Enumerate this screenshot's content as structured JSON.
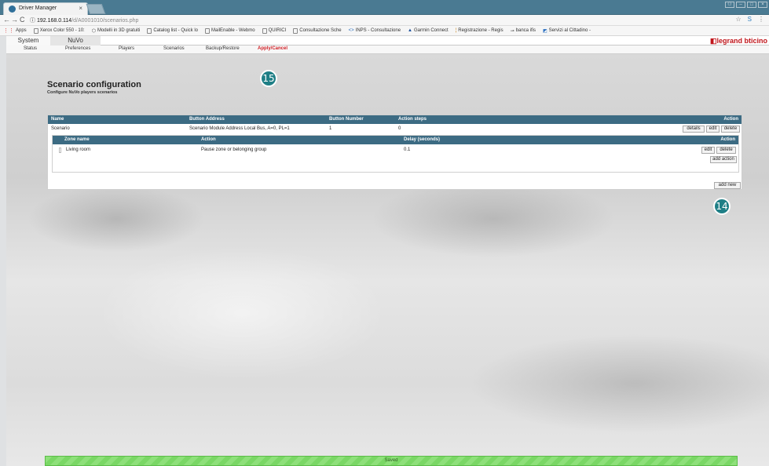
{
  "browser": {
    "tab_title": "Driver Manager",
    "url_host": "192.168.0.114",
    "url_path": "/d/A0001010/scenarios.php",
    "bookmarks": [
      "Apps",
      "Xerox Color 550 - 10:",
      "Modelli in 3D gratuiti",
      "Catalog list - Quick lo",
      "MailEnable - Webmo",
      "QUIRICI",
      "Consultazione Sche",
      "INPS - Consultazione",
      "Garmin Connect",
      "Registrazione - Regis",
      "banca ifis",
      "Servizi al Cittadino -"
    ]
  },
  "site": {
    "tabs": [
      "System",
      "NuVo"
    ],
    "brand_primary": "legrand",
    "brand_secondary": "bticino",
    "subnav": [
      "Status",
      "Preferences",
      "Players",
      "Scenarios",
      "Backup/Restore",
      "Apply/Cancel"
    ]
  },
  "page": {
    "title": "Scenario configuration",
    "subtitle": "Configure NuVo players scenarios"
  },
  "callouts": {
    "apply": "15",
    "add_new": "14"
  },
  "scenarios_table": {
    "headers": [
      "Name",
      "Button Address",
      "Button Number",
      "Action steps",
      "Action"
    ],
    "rows": [
      {
        "name": "Scenario",
        "address": "Scenario Module Address Local Bus, A=0, PL=1",
        "number": "1",
        "steps": "0"
      }
    ],
    "row_buttons": [
      "details",
      "edit",
      "delete"
    ]
  },
  "actions_table": {
    "headers": [
      "Zone name",
      "Action",
      "Delay (seconds)",
      "Action"
    ],
    "rows": [
      {
        "zone": "Living room",
        "action": "Pause zone or belonging group",
        "delay": "0.1"
      }
    ],
    "row_buttons": [
      "edit",
      "delete"
    ],
    "add_action": "add action"
  },
  "add_new": "add new",
  "status": "Saved",
  "colors": {
    "header": "#3c6b83",
    "accent_red": "#d01f25",
    "callout": "#1f7f86",
    "saved_bar": "#8ee07a"
  }
}
